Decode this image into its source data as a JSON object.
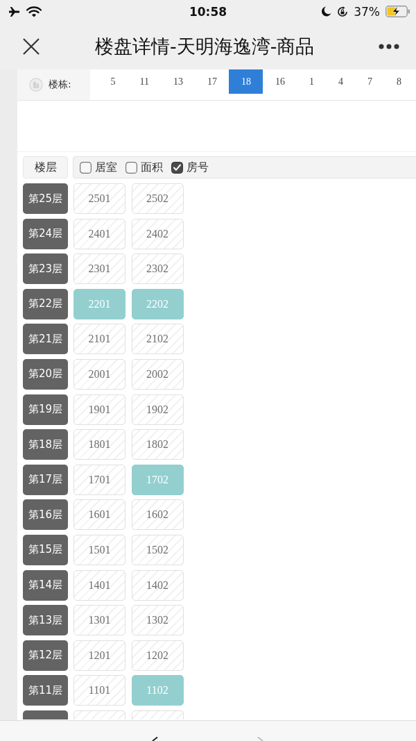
{
  "status_bar": {
    "time": "10:58",
    "battery": "37%"
  },
  "nav_bar": {
    "title": "楼盘详情-天明海逸湾-商品"
  },
  "buildings": {
    "label": "楼栋:",
    "tabs": [
      {
        "label": "5",
        "selected": false
      },
      {
        "label": "11",
        "selected": false
      },
      {
        "label": "13",
        "selected": false
      },
      {
        "label": "17",
        "selected": false
      },
      {
        "label": "18",
        "selected": true
      },
      {
        "label": "16",
        "selected": false
      },
      {
        "label": "1",
        "selected": false
      },
      {
        "label": "4",
        "selected": false
      },
      {
        "label": "7",
        "selected": false
      },
      {
        "label": "8",
        "selected": false
      }
    ]
  },
  "toolbar": {
    "floor_button": "楼层",
    "filters": [
      {
        "label": "居室",
        "checked": false
      },
      {
        "label": "面积",
        "checked": false
      },
      {
        "label": "房号",
        "checked": true
      }
    ]
  },
  "floors": [
    {
      "label": "第25层",
      "units": [
        {
          "number": "2501",
          "highlighted": false
        },
        {
          "number": "2502",
          "highlighted": false
        }
      ]
    },
    {
      "label": "第24层",
      "units": [
        {
          "number": "2401",
          "highlighted": false
        },
        {
          "number": "2402",
          "highlighted": false
        }
      ]
    },
    {
      "label": "第23层",
      "units": [
        {
          "number": "2301",
          "highlighted": false
        },
        {
          "number": "2302",
          "highlighted": false
        }
      ]
    },
    {
      "label": "第22层",
      "units": [
        {
          "number": "2201",
          "highlighted": true
        },
        {
          "number": "2202",
          "highlighted": true
        }
      ]
    },
    {
      "label": "第21层",
      "units": [
        {
          "number": "2101",
          "highlighted": false
        },
        {
          "number": "2102",
          "highlighted": false
        }
      ]
    },
    {
      "label": "第20层",
      "units": [
        {
          "number": "2001",
          "highlighted": false
        },
        {
          "number": "2002",
          "highlighted": false
        }
      ]
    },
    {
      "label": "第19层",
      "units": [
        {
          "number": "1901",
          "highlighted": false
        },
        {
          "number": "1902",
          "highlighted": false
        }
      ]
    },
    {
      "label": "第18层",
      "units": [
        {
          "number": "1801",
          "highlighted": false
        },
        {
          "number": "1802",
          "highlighted": false
        }
      ]
    },
    {
      "label": "第17层",
      "units": [
        {
          "number": "1701",
          "highlighted": false
        },
        {
          "number": "1702",
          "highlighted": true
        }
      ]
    },
    {
      "label": "第16层",
      "units": [
        {
          "number": "1601",
          "highlighted": false
        },
        {
          "number": "1602",
          "highlighted": false
        }
      ]
    },
    {
      "label": "第15层",
      "units": [
        {
          "number": "1501",
          "highlighted": false
        },
        {
          "number": "1502",
          "highlighted": false
        }
      ]
    },
    {
      "label": "第14层",
      "units": [
        {
          "number": "1401",
          "highlighted": false
        },
        {
          "number": "1402",
          "highlighted": false
        }
      ]
    },
    {
      "label": "第13层",
      "units": [
        {
          "number": "1301",
          "highlighted": false
        },
        {
          "number": "1302",
          "highlighted": false
        }
      ]
    },
    {
      "label": "第12层",
      "units": [
        {
          "number": "1201",
          "highlighted": false
        },
        {
          "number": "1202",
          "highlighted": false
        }
      ]
    },
    {
      "label": "第11层",
      "units": [
        {
          "number": "1101",
          "highlighted": false
        },
        {
          "number": "1102",
          "highlighted": true
        }
      ]
    }
  ],
  "cut_off_row": {
    "units": [
      {
        "highlighted": false
      },
      {
        "highlighted": false
      }
    ]
  },
  "bottom_bar": {
    "back": {
      "disabled": false
    },
    "forward": {
      "disabled": true
    }
  }
}
